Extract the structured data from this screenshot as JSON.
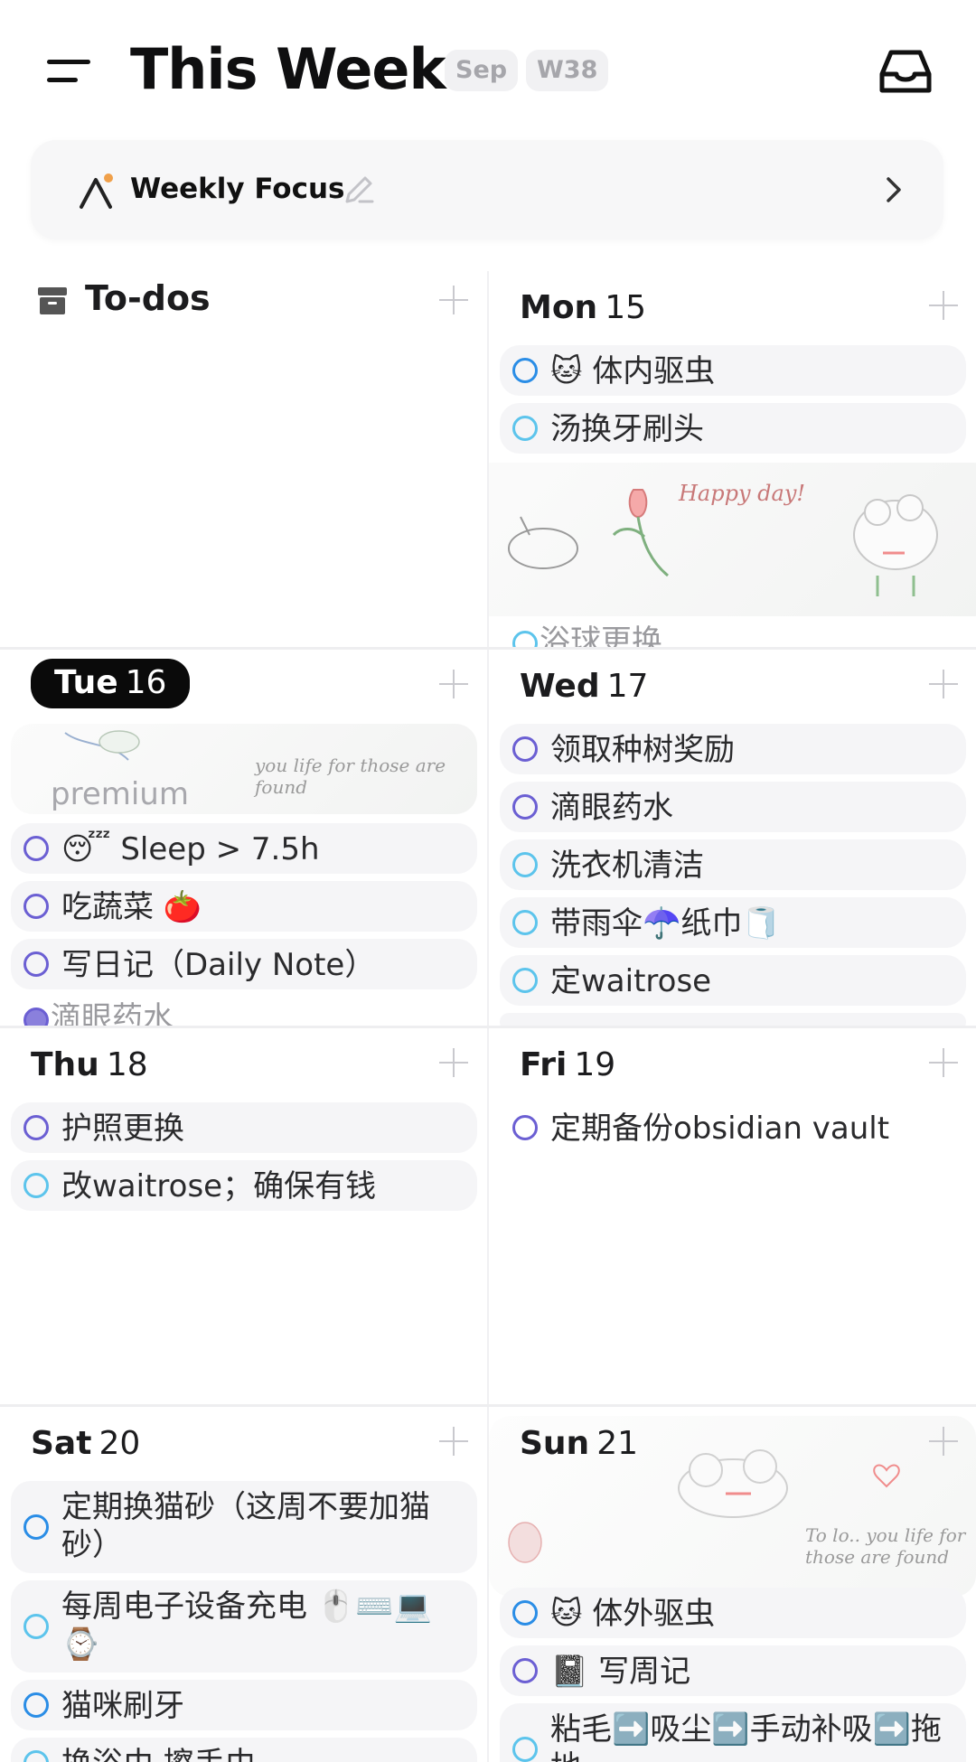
{
  "header": {
    "title": "This Week",
    "month_chip": "Sep",
    "week_chip": "W38"
  },
  "focus": {
    "label": "Weekly Focus"
  },
  "todos": {
    "title": "To-dos"
  },
  "days": {
    "mon": {
      "name": "Mon",
      "num": "15",
      "tasks": [
        "🐱 体内驱虫",
        "汤换牙刷头"
      ],
      "cut_task": "浴球更换",
      "sticker_text": "Happy day!"
    },
    "tue": {
      "name": "Tue",
      "num": "16",
      "cut_top": "premium",
      "sticker_text": "you life for those are found",
      "tasks": [
        "😴 Sleep > 7.5h",
        "吃蔬菜 🍅",
        "写日记（Daily Note）"
      ],
      "cut_task": "滴眼药水"
    },
    "wed": {
      "name": "Wed",
      "num": "17",
      "tasks": [
        "领取种树奖励",
        "滴眼药水",
        "洗衣机清洁",
        "带雨伞☂️纸巾🧻",
        "定waitrose"
      ]
    },
    "thu": {
      "name": "Thu",
      "num": "18",
      "tasks": [
        "护照更换",
        "改waitrose；确保有钱"
      ]
    },
    "fri": {
      "name": "Fri",
      "num": "19",
      "tasks": [
        "定期备份obsidian vault"
      ]
    },
    "sat": {
      "name": "Sat",
      "num": "20",
      "tasks": [
        "定期换猫砂（这周不要加猫砂）",
        "每周电子设备充电 🖱️⌨️💻⌚",
        "猫咪刷牙"
      ],
      "cut_task": "换浴巾 擦手巾"
    },
    "sun": {
      "name": "Sun",
      "num": "21",
      "sticker_text": "To lo.. you life for those are found",
      "tasks": [
        "🐱 体外驱虫",
        "📓 写周记",
        "粘毛➡️吸尘➡️手动补吸➡️拖地"
      ]
    }
  },
  "colors": {
    "purple": "#6b5fd3",
    "blue": "#2a8de6",
    "cyan": "#5cc4ec",
    "today_bg": "#0a0a0a"
  }
}
